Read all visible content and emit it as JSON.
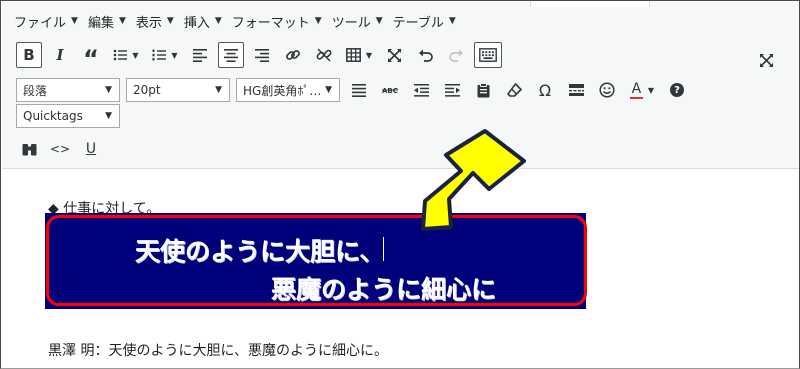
{
  "menubar": {
    "items": [
      {
        "label": "ファイル"
      },
      {
        "label": "編集"
      },
      {
        "label": "表示"
      },
      {
        "label": "挿入"
      },
      {
        "label": "フォーマット"
      },
      {
        "label": "ツール"
      },
      {
        "label": "テーブル"
      }
    ]
  },
  "toolbar": {
    "bold_label": "B",
    "italic_label": "I",
    "blockquote_label": "“",
    "format_select": "段落",
    "size_select": "20pt",
    "font_select": "HG創英角ﾎﾟ…",
    "quicktags_select": "Quicktags",
    "special_char_label": "Ω",
    "text_color_label": "A",
    "help_label": "?",
    "code_label": "<>",
    "underline_label": "U"
  },
  "editor": {
    "line1": "◆ 仕事に対して。",
    "banner_line1": "天使のように大胆に、",
    "banner_line2": "悪魔のように細心に",
    "quote": "黒澤 明：天使のように大胆に、悪魔のように細心に。"
  },
  "colors": {
    "banner_bg": "#00007a",
    "banner_border": "#ff0000",
    "arrow_fill": "#ffff00",
    "arrow_stroke": "#1a2240",
    "text_color_underline": "#d63638"
  }
}
